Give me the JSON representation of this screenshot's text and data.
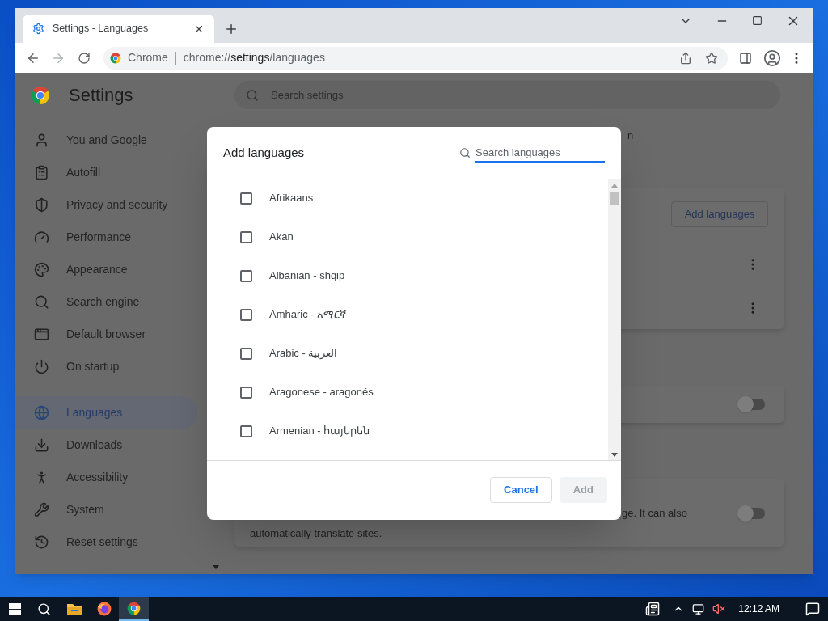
{
  "browser": {
    "tabs": [
      {
        "title": "Settings - Languages",
        "selected": true
      }
    ],
    "omnibox": {
      "chip": "Chrome",
      "url_scheme": "chrome://",
      "url_path": "settings",
      "url_rest": "/languages"
    }
  },
  "page": {
    "title": "Settings",
    "search_placeholder": "Search settings",
    "sidebar": [
      {
        "label": "You and Google",
        "selected": false
      },
      {
        "label": "Autofill",
        "selected": false
      },
      {
        "label": "Privacy and security",
        "selected": false
      },
      {
        "label": "Performance",
        "selected": false
      },
      {
        "label": "Appearance",
        "selected": false
      },
      {
        "label": "Search engine",
        "selected": false
      },
      {
        "label": "Default browser",
        "selected": false
      },
      {
        "label": "On startup",
        "selected": false
      },
      {
        "label": "Languages",
        "selected": true
      },
      {
        "label": "Downloads",
        "selected": false
      },
      {
        "label": "Accessibility",
        "selected": false
      },
      {
        "label": "System",
        "selected": false
      },
      {
        "label": "Reset settings",
        "selected": false
      }
    ],
    "main": {
      "heading_fragment": "n",
      "add_button": "Add languages",
      "spell_toggle": {
        "on": false
      },
      "translate": {
        "text_fragment": "ge. It can also",
        "text_line2": "automatically translate sites.",
        "on": false
      }
    }
  },
  "dialog": {
    "title": "Add languages",
    "search_placeholder": "Search languages",
    "languages": [
      {
        "label": "Afrikaans",
        "checked": false
      },
      {
        "label": "Akan",
        "checked": false
      },
      {
        "label": "Albanian - shqip",
        "checked": false
      },
      {
        "label": "Amharic - አማርኛ",
        "checked": false
      },
      {
        "label": "Arabic - العربية",
        "checked": false
      },
      {
        "label": "Aragonese - aragonés",
        "checked": false
      },
      {
        "label": "Armenian - հայերեն",
        "checked": false
      }
    ],
    "buttons": [
      {
        "label": "Cancel",
        "kind": "secondary",
        "disabled": false
      },
      {
        "label": "Add",
        "kind": "primary",
        "disabled": true
      }
    ]
  },
  "taskbar": {
    "clock": "12:12 AM"
  }
}
